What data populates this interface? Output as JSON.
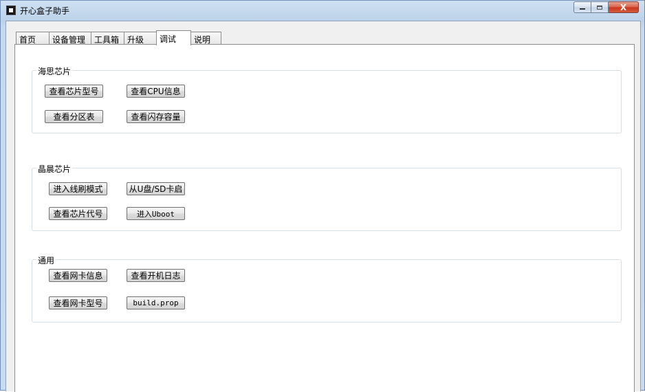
{
  "window": {
    "title": "开心盒子助手",
    "minimize_icon": "minimize-icon",
    "maximize_icon": "maximize-icon",
    "close_icon": "close-icon",
    "close_glyph": "X"
  },
  "tabs": [
    {
      "label": "首页"
    },
    {
      "label": "设备管理"
    },
    {
      "label": "工具箱"
    },
    {
      "label": "升级"
    },
    {
      "label": "调试",
      "active": true
    },
    {
      "label": "说明"
    }
  ],
  "groups": {
    "hisilicon": {
      "title": "海思芯片",
      "buttons": [
        "查看芯片型号",
        "查看CPU信息",
        "查看分区表",
        "查看闪存容量"
      ]
    },
    "amlogic": {
      "title": "晶晨芯片",
      "buttons": [
        "进入线刷模式",
        "从U盘/SD卡启",
        "查看芯片代号",
        "进入Uboot"
      ]
    },
    "general": {
      "title": "通用",
      "buttons": [
        "查看网卡信息",
        "查看开机日志",
        "查看网卡型号",
        "build.prop"
      ]
    }
  }
}
